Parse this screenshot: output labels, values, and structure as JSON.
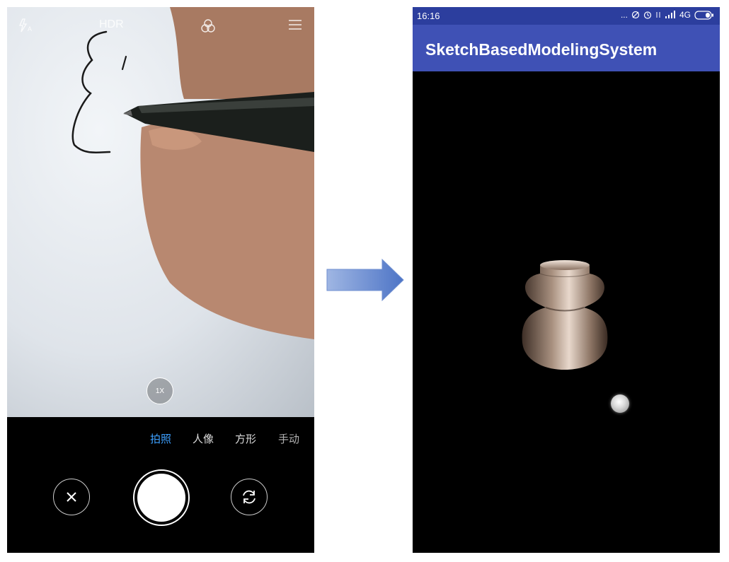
{
  "camera": {
    "hdr_label": "HDR",
    "zoom_label": "1X",
    "modes": [
      "拍照",
      "人像",
      "方形",
      "手动"
    ],
    "active_mode": "拍照",
    "accent_color": "#3da0ff",
    "icons": [
      "flash-auto-icon",
      "filters-icon",
      "menu-icon",
      "close-icon",
      "shutter-button",
      "switch-camera-icon"
    ]
  },
  "app": {
    "status_time": "16:16",
    "status_more": "...",
    "network_label": "4G",
    "title": "SketchBasedModelingSystem",
    "appbar_color": "#3f51b5",
    "statusbar_color": "#2c3e9e"
  }
}
